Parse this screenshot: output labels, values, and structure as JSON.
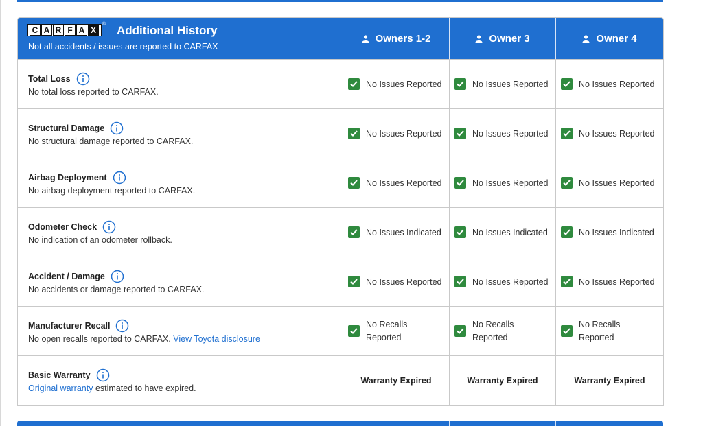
{
  "header": {
    "logo_letters": [
      "C",
      "A",
      "R",
      "F",
      "A",
      "X"
    ],
    "logo_text": "CARFAX",
    "title": "Additional History",
    "subtitle": "Not all accidents / issues are reported to CARFAX",
    "owners": [
      "Owners 1-2",
      "Owner 3",
      "Owner 4"
    ],
    "owner_icon": "person-icon"
  },
  "colors": {
    "header_bg": "#1f6fd0",
    "check_bg": "#2f8a3e",
    "link": "#1f6fd0"
  },
  "rows": [
    {
      "title": "Total Loss",
      "desc": "No total loss reported to CARFAX.",
      "values": [
        "No Issues Reported",
        "No Issues Reported",
        "No Issues Reported"
      ]
    },
    {
      "title": "Structural Damage",
      "desc": "No structural damage reported to CARFAX.",
      "values": [
        "No Issues Reported",
        "No Issues Reported",
        "No Issues Reported"
      ]
    },
    {
      "title": "Airbag Deployment",
      "desc": "No airbag deployment reported to CARFAX.",
      "values": [
        "No Issues Reported",
        "No Issues Reported",
        "No Issues Reported"
      ]
    },
    {
      "title": "Odometer Check",
      "desc": "No indication of an odometer rollback.",
      "values": [
        "No Issues Indicated",
        "No Issues Indicated",
        "No Issues Indicated"
      ]
    },
    {
      "title": "Accident / Damage",
      "desc": "No accidents or damage reported to CARFAX.",
      "values": [
        "No Issues Reported",
        "No Issues Reported",
        "No Issues Reported"
      ]
    },
    {
      "title": "Manufacturer Recall",
      "desc": "No open recalls reported to CARFAX.",
      "desc_link": "View Toyota disclosure",
      "values": [
        "No Recalls",
        "No Recalls",
        "No Recalls"
      ],
      "values_line2": [
        "Reported",
        "Reported",
        "Reported"
      ]
    },
    {
      "title": "Basic Warranty",
      "desc_link": "Original warranty",
      "desc": "estimated to have expired.",
      "values": [
        "Warranty Expired",
        "Warranty Expired",
        "Warranty Expired"
      ]
    }
  ]
}
